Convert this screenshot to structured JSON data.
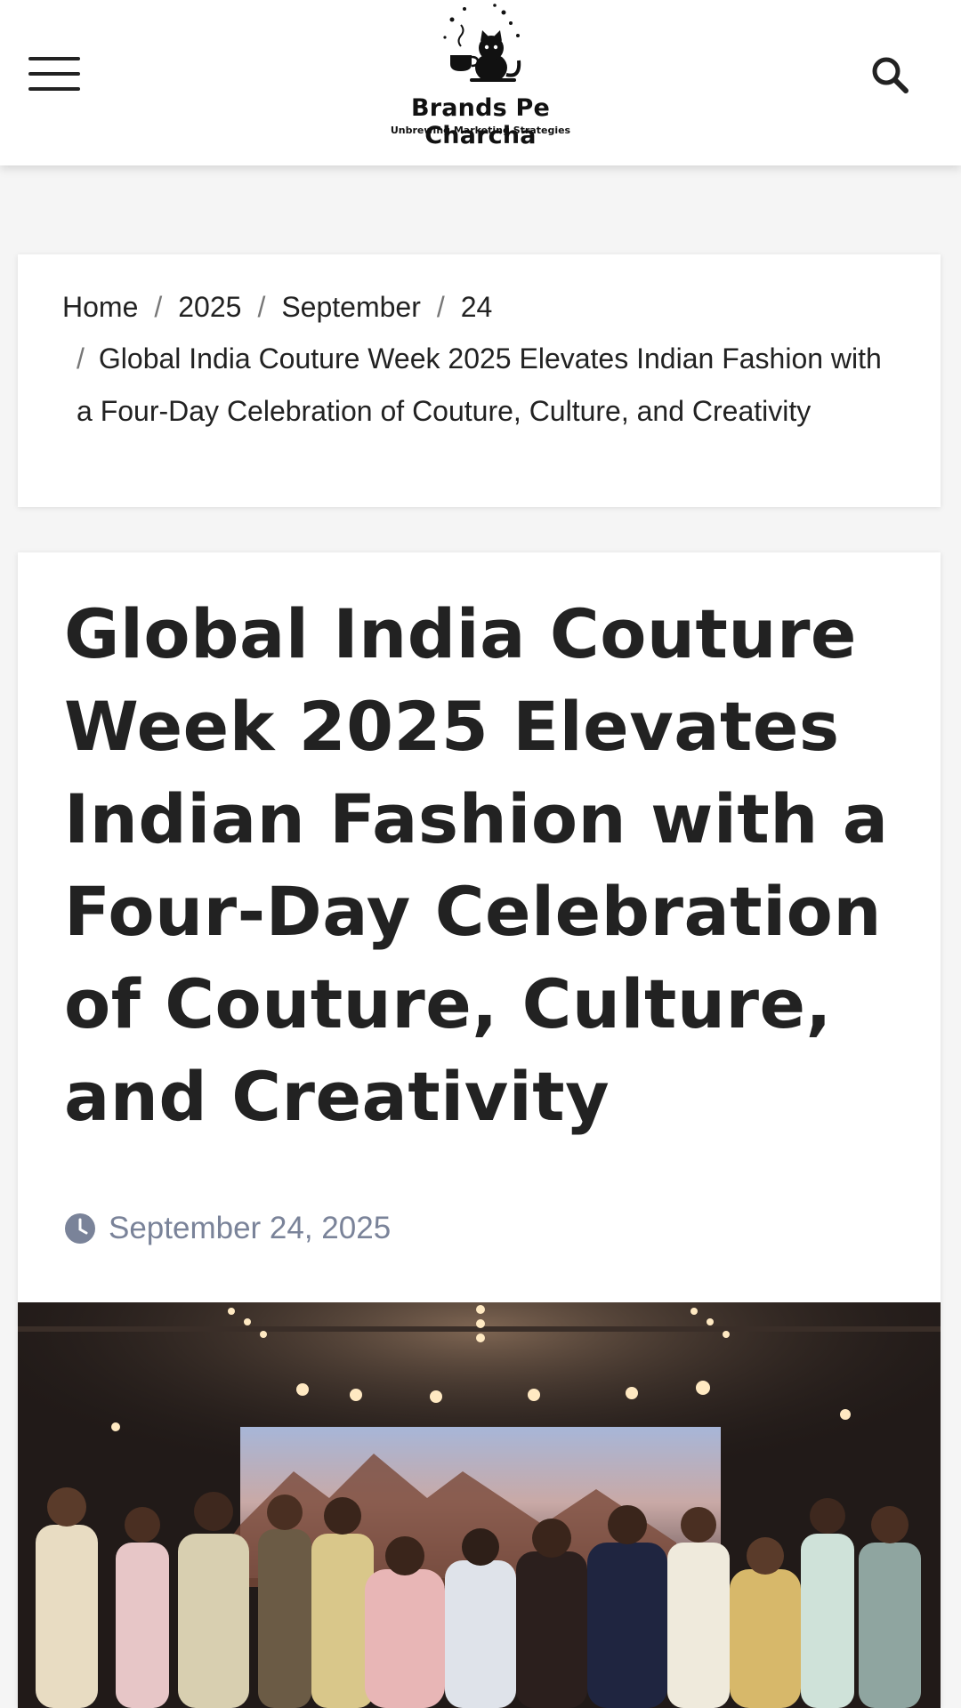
{
  "header": {
    "logo_title": "Brands Pe Charcha",
    "logo_tagline": "Unbrewing Marketing Strategies",
    "menu_icon": "hamburger-menu-icon",
    "search_icon": "search-icon"
  },
  "breadcrumb": {
    "items": [
      "Home",
      "2025",
      "September",
      "24"
    ],
    "separator": "/",
    "current": "Global India Couture Week 2025 Elevates Indian Fashion with a Four-Day Celebration of Couture, Culture, and Creativity"
  },
  "article": {
    "title": "Global India Couture Week 2025 Elevates Indian Fashion with a Four-Day Celebration of Couture, Culture, and Creativity",
    "date": "September 24, 2025",
    "date_icon": "clock-icon",
    "hero_image": "runway-group-photo"
  },
  "colors": {
    "meta_text": "#7a8399",
    "title_text": "#222222",
    "header_bg": "#ffffff",
    "page_bg": "#f5f5f5"
  }
}
